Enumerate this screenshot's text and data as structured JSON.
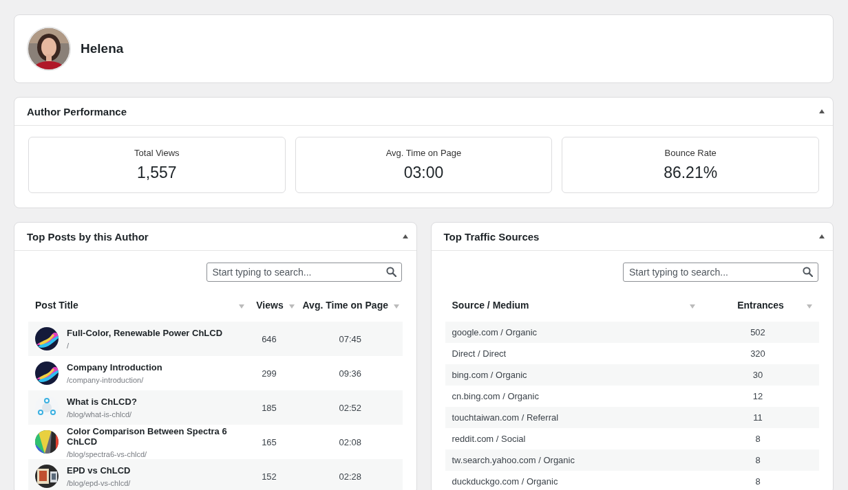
{
  "profile": {
    "name": "Helena"
  },
  "author_performance": {
    "title": "Author Performance",
    "expanded": true,
    "stats": [
      {
        "label": "Total Views",
        "value": "1,557"
      },
      {
        "label": "Avg. Time on Page",
        "value": "03:00"
      },
      {
        "label": "Bounce Rate",
        "value": "86.21%"
      }
    ]
  },
  "top_posts": {
    "title": "Top Posts by this Author",
    "expanded": true,
    "search": {
      "placeholder": "Start typing to search..."
    },
    "columns": [
      "Post Title",
      "Views",
      "Avg. Time on Page"
    ],
    "rows": [
      {
        "title": "Full-Color, Renewable Power ChLCD",
        "path": "/",
        "views": "646",
        "time": "07:45"
      },
      {
        "title": "Company Introduction",
        "path": "/company-introduction/",
        "views": "299",
        "time": "09:36"
      },
      {
        "title": "What is ChLCD?",
        "path": "/blog/what-is-chlcd/",
        "views": "185",
        "time": "02:52"
      },
      {
        "title": "Color Comparison Between Spectra 6 ChLCD",
        "path": "/blog/spectra6-vs-chlcd/",
        "views": "165",
        "time": "02:08"
      },
      {
        "title": "EPD vs ChLCD",
        "path": "/blog/epd-vs-chlcd/",
        "views": "152",
        "time": "02:28"
      }
    ]
  },
  "top_traffic_sources": {
    "title": "Top Traffic Sources",
    "expanded": true,
    "search": {
      "placeholder": "Start typing to search..."
    },
    "columns": [
      "Source / Medium",
      "Entrances"
    ],
    "rows": [
      {
        "source": "google.com / Organic",
        "entrances": "502"
      },
      {
        "source": "Direct / Direct",
        "entrances": "320"
      },
      {
        "source": "bing.com / Organic",
        "entrances": "30"
      },
      {
        "source": "cn.bing.com / Organic",
        "entrances": "12"
      },
      {
        "source": "touchtaiwan.com / Referral",
        "entrances": "11"
      },
      {
        "source": "reddit.com / Social",
        "entrances": "8"
      },
      {
        "source": "tw.search.yahoo.com / Organic",
        "entrances": "8"
      },
      {
        "source": "duckduckgo.com / Organic",
        "entrances": "8"
      }
    ]
  }
}
